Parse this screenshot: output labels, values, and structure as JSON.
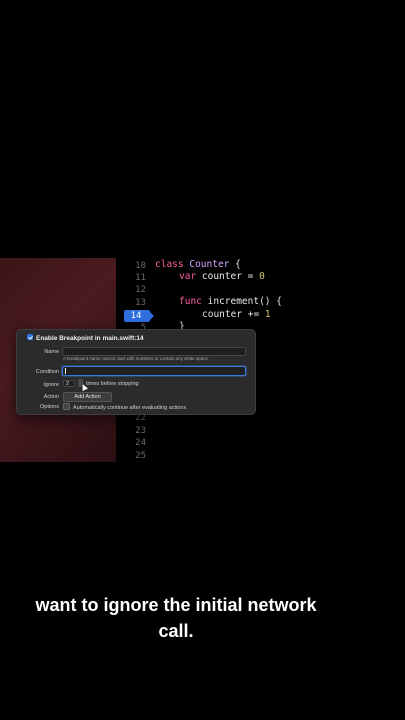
{
  "line_numbers": [
    "10",
    "11",
    "12",
    "13",
    "14",
    "5",
    "22",
    "23",
    "24",
    "25"
  ],
  "breakpoint_line": "14",
  "code": {
    "l10": {
      "kw": "class",
      "name": "Counter",
      "rest": " {"
    },
    "l11": {
      "kw": "var",
      "rest": " counter = ",
      "num": "0"
    },
    "l13": {
      "kw": "func",
      "rest": " increment() {"
    },
    "l14": {
      "text": "counter += ",
      "num": "1"
    },
    "l15": {
      "text": "}"
    }
  },
  "popover": {
    "title": "Enable Breakpoint in main.swift:14",
    "name_label": "Name",
    "name_hint": "A breakpoint name cannot start with numbers or contain any white space.",
    "condition_label": "Condition",
    "ignore_label": "Ignore",
    "ignore_value": "2",
    "ignore_suffix": "times before stopping",
    "action_label": "Action",
    "add_action_button": "Add Action",
    "options_label": "Options",
    "options_text": "Automatically continue after evaluating actions"
  },
  "caption": {
    "line1": "want to ignore the initial network",
    "line2": "call."
  },
  "colors": {
    "keyword": "#fc5fa3",
    "type": "#d0a8ff",
    "number": "#d9c97c",
    "breakpoint": "#2f6fe0"
  }
}
